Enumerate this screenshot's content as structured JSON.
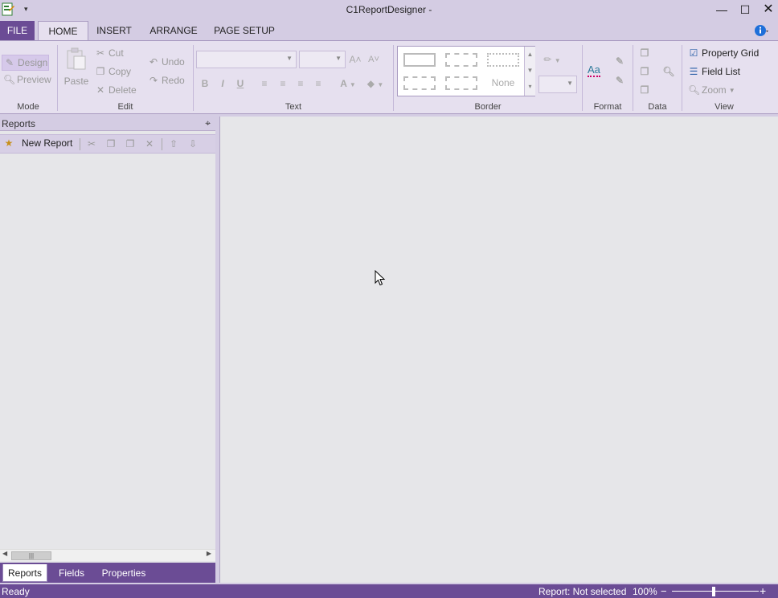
{
  "window": {
    "title": "C1ReportDesigner -",
    "qat_label": "▾"
  },
  "tabs": {
    "file": "FILE",
    "home": "HOME",
    "insert": "INSERT",
    "arrange": "ARRANGE",
    "page_setup": "PAGE SETUP"
  },
  "ribbon": {
    "mode": {
      "label": "Mode",
      "design": "Design",
      "preview": "Preview"
    },
    "edit": {
      "label": "Edit",
      "paste": "Paste",
      "cut": "Cut",
      "copy": "Copy",
      "delete": "Delete",
      "undo": "Undo",
      "redo": "Redo"
    },
    "text": {
      "label": "Text",
      "bold": "B",
      "italic": "I",
      "underline": "U"
    },
    "border": {
      "label": "Border",
      "none": "None"
    },
    "format": {
      "label": "Format",
      "aa": "Aa"
    },
    "data": {
      "label": "Data"
    },
    "view": {
      "label": "View",
      "property_grid": "Property Grid",
      "field_list": "Field List",
      "zoom": "Zoom"
    }
  },
  "reports_panel": {
    "title": "Reports",
    "new_report": "New Report",
    "bottom_tabs": {
      "reports": "Reports",
      "fields": "Fields",
      "properties": "Properties"
    }
  },
  "status": {
    "ready": "Ready",
    "report": "Report: Not selected",
    "zoom": "100%"
  },
  "colors": {
    "accent": "#6b4c95",
    "ribbon": "#e6e0ef",
    "chrome": "#d4cce3"
  }
}
